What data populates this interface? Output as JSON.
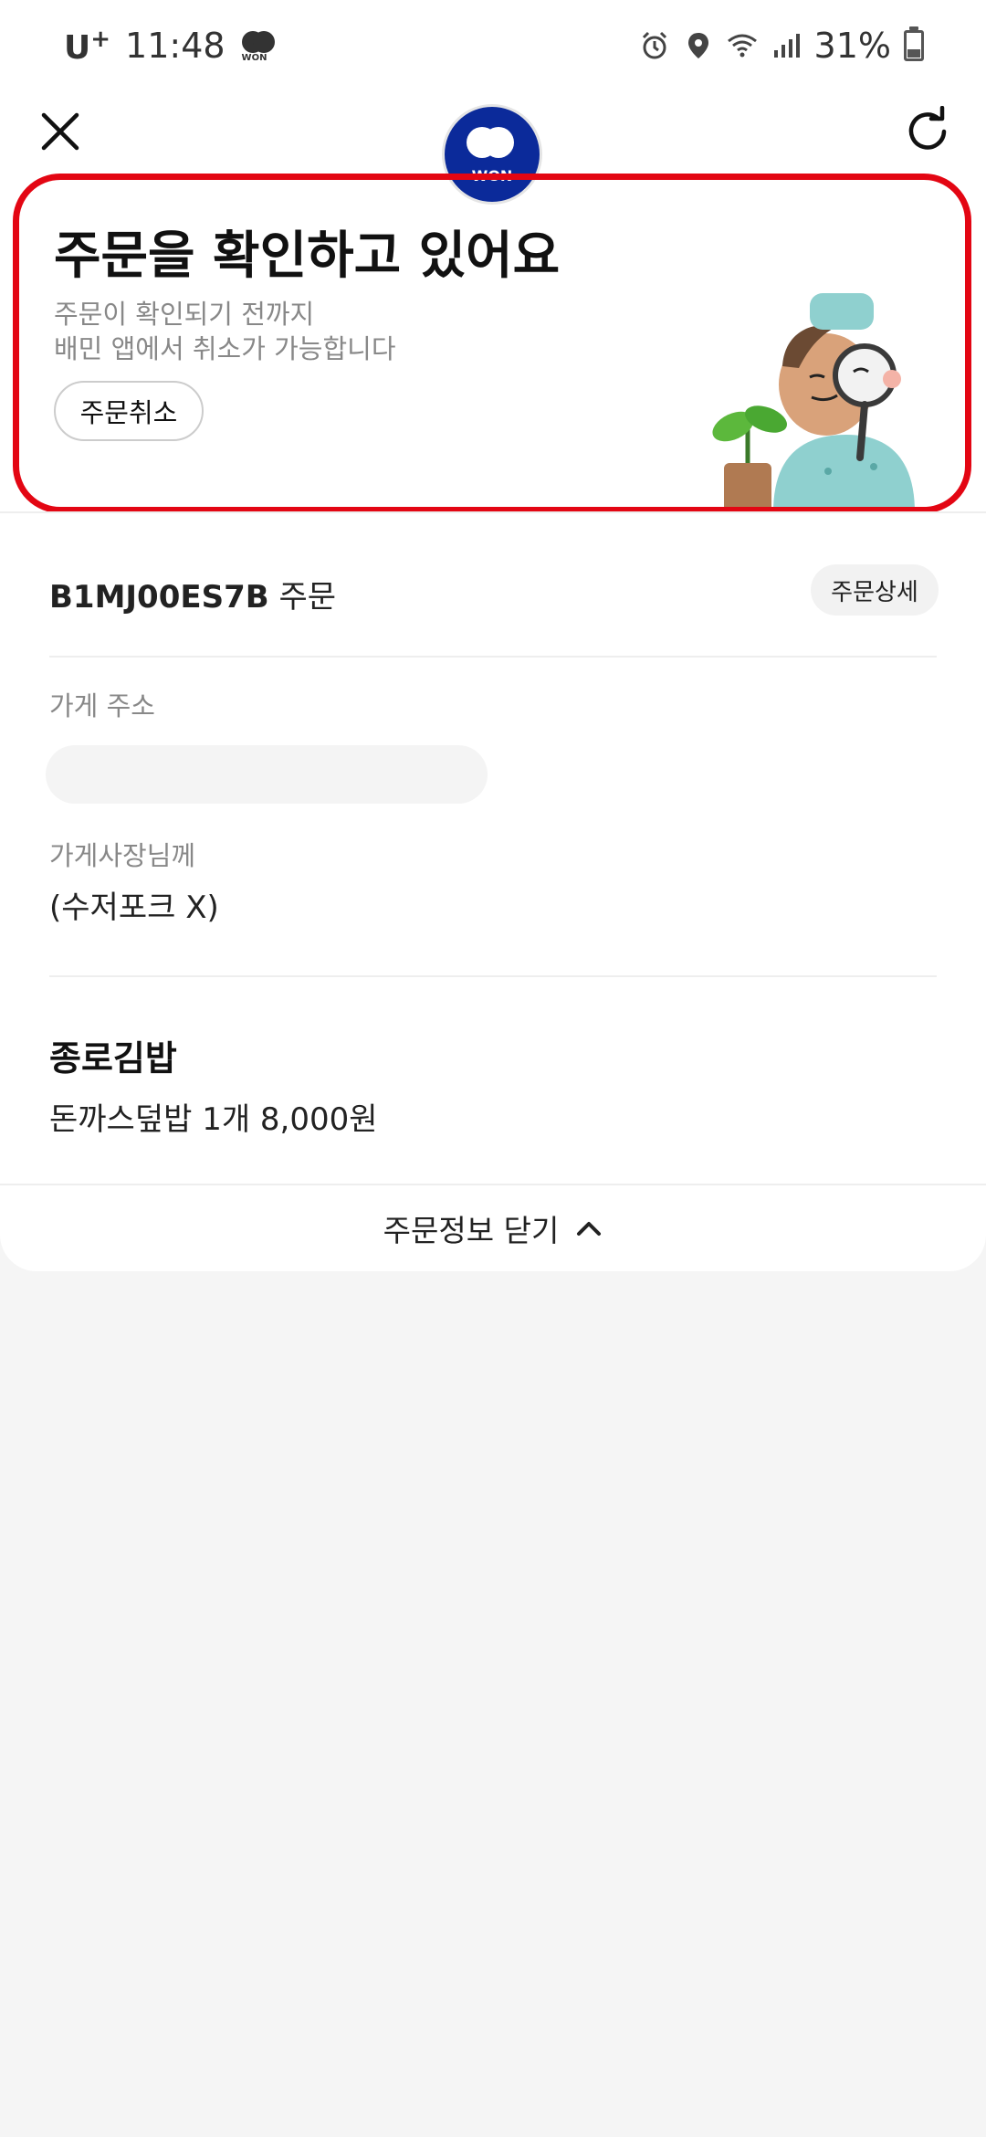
{
  "status_bar": {
    "carrier": "U",
    "carrier_plus": "+",
    "time": "11:48",
    "won_badge": "WON",
    "battery": "31%",
    "battery_level": 0.31
  },
  "toolbar": {
    "logo_text": "WON",
    "brand_color": "#0b2a9a"
  },
  "hero": {
    "title": "주문을 확인하고 있어요",
    "subtitle_line1": "주문이 확인되기 전까지",
    "subtitle_line2": "배민 앱에서 취소가 가능합니다",
    "cancel_label": "주문취소",
    "highlight_color": "#e30613"
  },
  "order": {
    "id": "B1MJ00ES7B",
    "suffix": "주문",
    "detail_label": "주문상세"
  },
  "store": {
    "address_label": "가게 주소",
    "memo_label": "가게사장님께",
    "memo_value": "(수저포크 X)",
    "name": "종로김밥",
    "menu": "돈까스덮밥 1개 8,000원"
  },
  "footer": {
    "close_label": "주문정보 닫기"
  }
}
